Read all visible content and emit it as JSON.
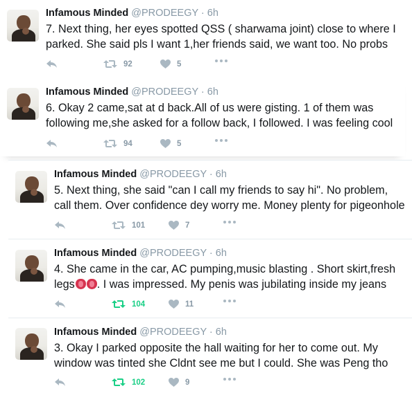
{
  "tweets": [
    {
      "name": "Infamous Minded",
      "handle": "@PRODEEGY · 6h",
      "lines": [
        "7. Next thing, her eyes spotted QSS ( sharwama joint) close to where I",
        "parked. She said pls I want 1,her friends said, we want too. No probs"
      ],
      "retweets": "92",
      "likes": "5",
      "retweeted": false
    },
    {
      "name": "Infamous Minded",
      "handle": "@PRODEEGY · 6h",
      "lines": [
        "6. Okay 2 came,sat at d back.All of us were gisting. 1 of them was",
        "following me,she asked for a follow back, I followed. I was feeling cool"
      ],
      "retweets": "94",
      "likes": "5",
      "retweeted": false
    },
    {
      "name": "Infamous Minded",
      "handle": "@PRODEEGY · 6h",
      "lines": [
        "5. Next thing, she said \"can I call my friends to say hi\". No problem,",
        "call them. Over confidence dey worry me. Money plenty for pigeonhole"
      ],
      "retweets": "101",
      "likes": "7",
      "retweeted": false
    },
    {
      "name": "Infamous Minded",
      "handle": "@PRODEEGY · 6h",
      "lines": [
        "4. She came in the car, AC pumping,music blasting . Short skirt,fresh",
        "legs",
        ". I was impressed. My penis was jubilating inside my jeans"
      ],
      "retweets": "104",
      "likes": "11",
      "retweeted": true
    },
    {
      "name": "Infamous Minded",
      "handle": "@PRODEEGY · 6h",
      "lines": [
        "3. Okay I parked opposite the hall waiting for her to come out. My",
        "window was tinted she Cldnt see me but I could. She was Peng tho"
      ],
      "retweets": "102",
      "likes": "9",
      "retweeted": true
    }
  ],
  "icons": {
    "reply": "reply-icon",
    "retweet": "retweet-icon",
    "like": "heart-icon",
    "more": "more-icon",
    "emoji": "tongue-emoji"
  },
  "colors": {
    "text": "#14171a",
    "muted": "#8899a6",
    "retweet_active": "#19cf86",
    "divider": "#e6ecf0"
  }
}
